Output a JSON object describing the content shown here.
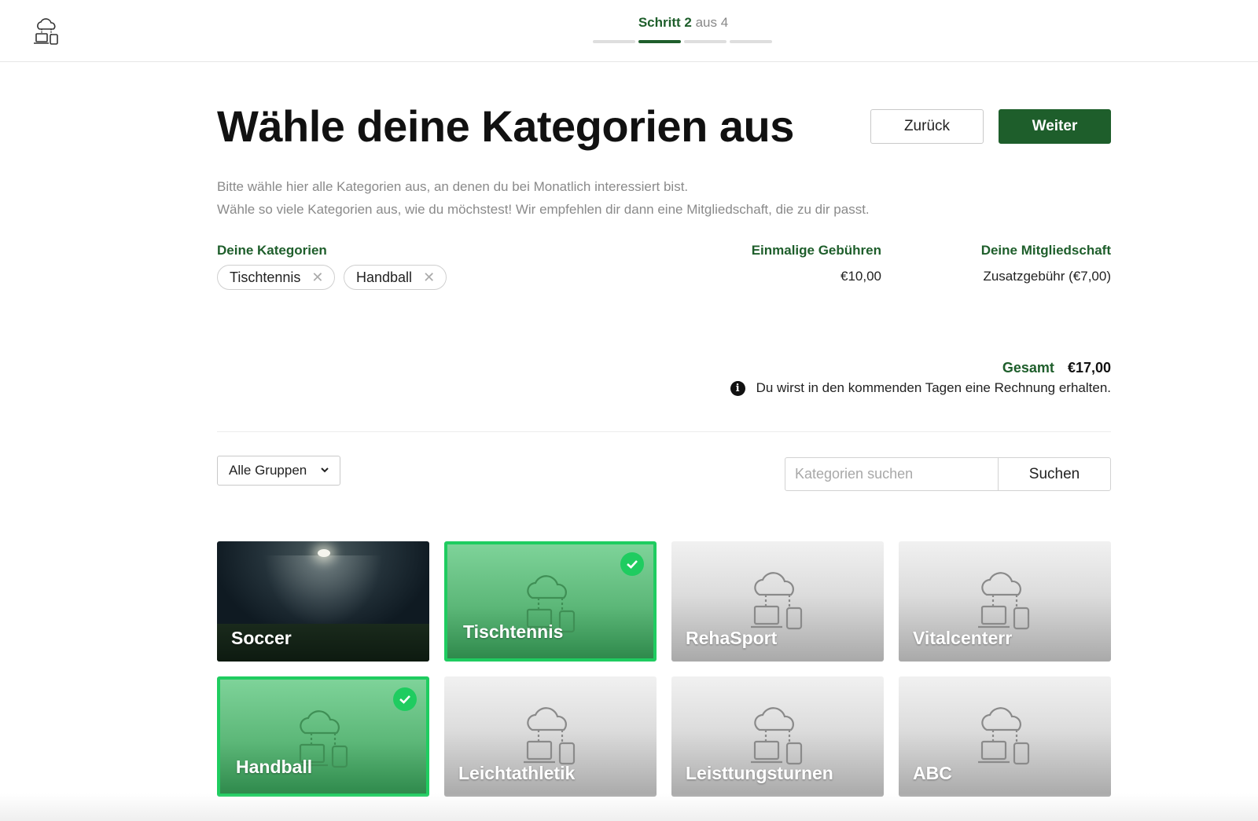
{
  "header": {
    "step_current": "Schritt 2",
    "step_total": "aus 4",
    "step_progress": {
      "current": 2,
      "total": 4
    }
  },
  "main": {
    "title": "Wähle deine Kategorien aus",
    "back_label": "Zurück",
    "next_label": "Weiter",
    "intro_line1": "Bitte wähle hier alle Kategorien aus, an denen du bei Monatlich interessiert bist.",
    "intro_line2": "Wähle so viele Kategorien aus, wie du möchstest! Wir empfehlen dir dann eine Mitgliedschaft, die zu dir passt."
  },
  "summary": {
    "categories_label": "Deine Kategorien",
    "selected_chips": [
      "Tischtennis",
      "Handball"
    ],
    "chip_remove_glyph": "✕",
    "fees_label": "Einmalige Gebühren",
    "fees_value": "€10,00",
    "membership_label": "Deine Mitgliedschaft",
    "membership_value": "Zusatzgebühr (€7,00)",
    "total_label": "Gesamt",
    "total_value": "€17,00",
    "note": "Du wirst in den kommenden Tagen eine Rechnung erhalten."
  },
  "filters": {
    "group_select": "Alle Gruppen",
    "search_placeholder": "Kategorien suchen",
    "search_button": "Suchen"
  },
  "tiles": [
    {
      "label": "Soccer",
      "style": "photo",
      "selected": false
    },
    {
      "label": "Tischtennis",
      "style": "icon",
      "selected": true
    },
    {
      "label": "RehaSport",
      "style": "icon",
      "selected": false
    },
    {
      "label": "Vitalcenterr",
      "style": "icon",
      "selected": false
    },
    {
      "label": "Handball",
      "style": "icon",
      "selected": true
    },
    {
      "label": "Leichtathletik",
      "style": "icon",
      "selected": false
    },
    {
      "label": "Leisttungsturnen",
      "style": "icon",
      "selected": false
    },
    {
      "label": "ABC",
      "style": "icon",
      "selected": false
    }
  ],
  "colors": {
    "brand_green": "#1e5e2b",
    "selected_border": "#1fcc60"
  }
}
